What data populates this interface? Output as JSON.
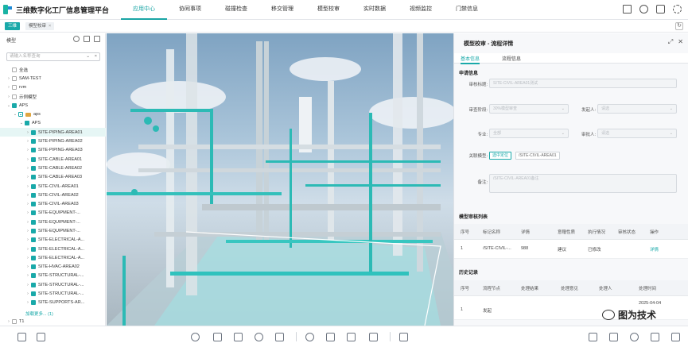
{
  "app": {
    "title": "三维数字化工厂信息管理平台"
  },
  "nav": [
    {
      "label": "应用中心",
      "active": true
    },
    {
      "label": "协同事项"
    },
    {
      "label": "碰撞检查"
    },
    {
      "label": "移交管理"
    },
    {
      "label": "模型校审"
    },
    {
      "label": "实时数据"
    },
    {
      "label": "视频监控"
    },
    {
      "label": "门禁信息"
    }
  ],
  "top_icons": [
    "home-icon",
    "search-icon",
    "fullscreen-icon",
    "settings-icon"
  ],
  "tabs": {
    "main": "三维",
    "sub": "模型校审",
    "sub_close": "×"
  },
  "left_panel": {
    "title": "模型",
    "search_placeholder": "请输入名称查询",
    "tree": [
      {
        "label": "全选",
        "level": 0,
        "check": "off",
        "arrow": ""
      },
      {
        "label": "SAM-TEST",
        "level": 0,
        "check": "off",
        "arrow": "›",
        "folder": false
      },
      {
        "label": "rvm",
        "level": 0,
        "check": "off",
        "arrow": "›"
      },
      {
        "label": "示例模型",
        "level": 0,
        "check": "off",
        "arrow": "›"
      },
      {
        "label": "APS",
        "level": 0,
        "check": "on",
        "arrow": "⌄"
      },
      {
        "label": "aps",
        "level": 1,
        "check": "half",
        "arrow": "⌄",
        "folder": true
      },
      {
        "label": "APS",
        "level": 2,
        "check": "on",
        "arrow": "⌄"
      },
      {
        "label": "SITE-PIPING-AREA01",
        "level": 3,
        "check": "on",
        "arrow": "›",
        "selected": true
      },
      {
        "label": "SITE-PIPING-AREA02",
        "level": 3,
        "check": "on",
        "arrow": "›"
      },
      {
        "label": "SITE-PIPING-AREA03",
        "level": 3,
        "check": "on",
        "arrow": "›"
      },
      {
        "label": "SITE-CABLE-AREA01",
        "level": 3,
        "check": "on",
        "arrow": "›"
      },
      {
        "label": "SITE-CABLE-AREA02",
        "level": 3,
        "check": "on",
        "arrow": "›"
      },
      {
        "label": "SITE-CABLE-AREA03",
        "level": 3,
        "check": "on",
        "arrow": "›"
      },
      {
        "label": "SITE-CIVIL-AREA01",
        "level": 3,
        "check": "on",
        "arrow": "›"
      },
      {
        "label": "SITE-CIVIL-AREA02",
        "level": 3,
        "check": "on",
        "arrow": "›"
      },
      {
        "label": "SITE-CIVIL-AREA03",
        "level": 3,
        "check": "on",
        "arrow": "›"
      },
      {
        "label": "SITE-EQUIPMENT-...",
        "level": 3,
        "check": "on",
        "arrow": "›"
      },
      {
        "label": "SITE-EQUIPMENT-...",
        "level": 3,
        "check": "on",
        "arrow": "›"
      },
      {
        "label": "SITE-EQUIPMENT-...",
        "level": 3,
        "check": "on",
        "arrow": "›"
      },
      {
        "label": "SITE-ELECTRICAL-A...",
        "level": 3,
        "check": "on",
        "arrow": "›"
      },
      {
        "label": "SITE-ELECTRICAL-A...",
        "level": 3,
        "check": "on",
        "arrow": "›"
      },
      {
        "label": "SITE-ELECTRICAL-A...",
        "level": 3,
        "check": "on",
        "arrow": "›"
      },
      {
        "label": "SITE-HVAC-AREA02",
        "level": 3,
        "check": "on",
        "arrow": "›"
      },
      {
        "label": "SITE-STRUCTURAL-...",
        "level": 3,
        "check": "on",
        "arrow": "›"
      },
      {
        "label": "SITE-STRUCTURAL-...",
        "level": 3,
        "check": "on",
        "arrow": "›"
      },
      {
        "label": "SITE-STRUCTURAL-...",
        "level": 3,
        "check": "on",
        "arrow": "›"
      },
      {
        "label": "SITE-SUPPORTS-AR...",
        "level": 3,
        "check": "on",
        "arrow": "›"
      }
    ],
    "load_more": "加载更多... (1)",
    "last_item": "T1"
  },
  "detail": {
    "title": "模型校审 - 流程详情",
    "tabs": [
      "基本信息",
      "流程信息"
    ],
    "section_apply": "申请信息",
    "fields": {
      "review_title_label": "审核标题:",
      "review_title_value": "SITE-CIVIL-AREA01测试",
      "stage_label": "审查阶段:",
      "stage_value": "30%模型审查",
      "initiator_label": "发起人:",
      "initiator_value": "请选",
      "major_label": "专业:",
      "major_value": "全部",
      "reviewer_label": "审批人:",
      "reviewer_value": "请选",
      "linked_label": "关联模型:",
      "linked_button": "选中定位",
      "linked_value": "/SITE-CIVIL-AREA01",
      "remark_label": "备注:",
      "remark_value": "/SITE-CIVIL-AREA01备注"
    },
    "review_list_title": "模型审核列表",
    "review_columns": [
      "序号",
      "标记名称",
      "详情",
      "意赠性质",
      "执行情况",
      "审核状态",
      "操作"
    ],
    "review_rows": [
      [
        "1",
        "/SITE-CIVIL-...",
        "988",
        "建议",
        "已修改",
        "",
        "详情"
      ]
    ],
    "history_title": "历史记录",
    "history_columns": [
      "序号",
      "流程节点",
      "处理结果",
      "处理意见",
      "处理人",
      "处理时间"
    ],
    "history_rows": [
      [
        "1",
        "发起",
        "",
        "",
        "",
        "2025-04-04"
      ]
    ]
  },
  "bottom_tools": [
    "layers-icon",
    "box-icon",
    "target-icon",
    "cube-icon",
    "cube-outline-icon",
    "link-icon",
    "cube-rotate-icon",
    "palette-icon",
    "measure-icon",
    "navigate-icon",
    "grid-icon",
    "section-icon",
    "camera-icon",
    "rotate-icon",
    "view-icon",
    "roam-icon",
    "record-icon"
  ],
  "watermark": "图为技术",
  "colors": {
    "accent": "#19a9a9",
    "topbar": "#ffffff",
    "panel_bg": "#f7f8fa"
  }
}
